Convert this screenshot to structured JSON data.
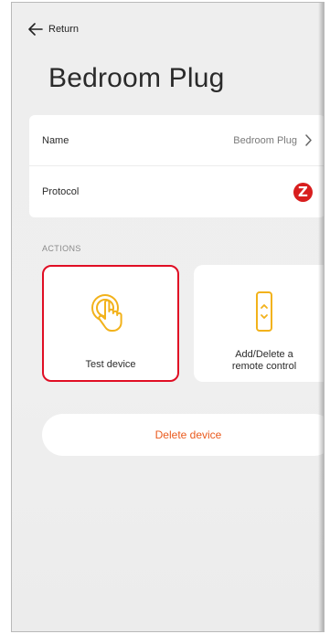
{
  "header": {
    "back_label": "Return",
    "title": "Bedroom Plug"
  },
  "info": {
    "name_label": "Name",
    "name_value": "Bedroom Plug",
    "protocol_label": "Protocol",
    "protocol_badge": "Z"
  },
  "actions": {
    "section_label": "ACTIONS",
    "test_label": "Test device",
    "remote_label_line1": "Add/Delete a",
    "remote_label_line2": "remote control"
  },
  "delete_label": "Delete device",
  "icons": {
    "back": "arrow-left-icon",
    "chevron": "chevron-right-icon",
    "protocol": "z-wave-logo",
    "test": "hand-tap-icon",
    "remote": "remote-control-icon"
  },
  "colors": {
    "accent": "#f2b21b",
    "highlight_border": "#e00e24",
    "delete_text": "#ea5a1d",
    "zwave_red": "#d81e1e"
  }
}
